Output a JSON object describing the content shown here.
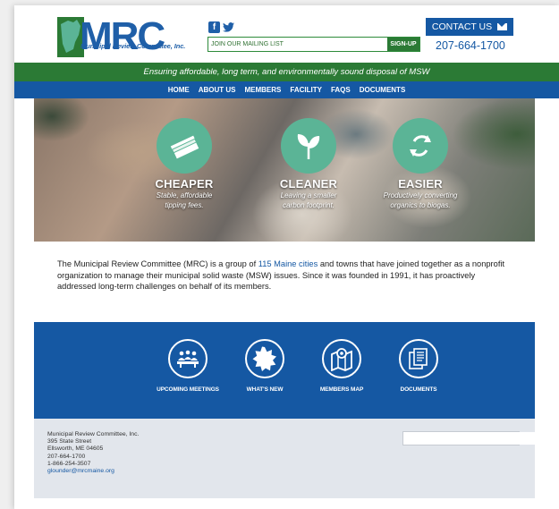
{
  "header": {
    "logo_text": "MRC",
    "logo_caption": "Municipal Review Committee, Inc.",
    "social": [
      "facebook-icon",
      "twitter-icon"
    ],
    "mailing_placeholder": "JOIN OUR MAILING LIST",
    "signup_label": "SIGN-UP",
    "contact_label": "CONTACT US",
    "phone": "207-664-1700"
  },
  "tagline": "Ensuring affordable, long term, and environmentally sound disposal of MSW",
  "nav": {
    "items": [
      "HOME",
      "ABOUT US",
      "MEMBERS",
      "FACILITY",
      "FAQS",
      "DOCUMENTS"
    ]
  },
  "hero": {
    "features": [
      {
        "title": "CHEAPER",
        "line1": "Stable, affordable",
        "line2": "tipping fees.",
        "icon": "money-stack-icon"
      },
      {
        "title": "CLEANER",
        "line1": "Leaving a smaller",
        "line2": "carbon footprint.",
        "icon": "leaf-icon"
      },
      {
        "title": "EASIER",
        "line1": "Productively converting",
        "line2": "organics to biogas.",
        "icon": "recycle-icon"
      }
    ]
  },
  "intro": {
    "before": "The Municipal Review Committee (MRC) is a group of ",
    "link": "115 Maine cities",
    "after": " and towns that have joined together as a nonprofit organization to manage their municipal solid waste (MSW) issues. Since it was founded in 1991, it has proactively addressed long-term challenges on behalf of its members."
  },
  "band": {
    "items": [
      {
        "label": "UPCOMING MEETINGS",
        "icon": "people-meeting-icon"
      },
      {
        "label": "WHAT'S NEW",
        "icon": "starburst-icon"
      },
      {
        "label": "MEMBERS MAP",
        "icon": "map-pin-icon"
      },
      {
        "label": "DOCUMENTS",
        "icon": "documents-icon"
      }
    ]
  },
  "footer": {
    "org": "Municipal Review Committee, Inc.",
    "street": "395 State Street",
    "city": "Ellsworth, ME 04605",
    "phone": "207-664-1700",
    "tollfree": "1-866-254-3507",
    "email": "glounder@mrcmaine.org"
  },
  "colors": {
    "brand_blue": "#1558a3",
    "brand_green": "#2b7a35",
    "feature_green": "#5bb496"
  }
}
